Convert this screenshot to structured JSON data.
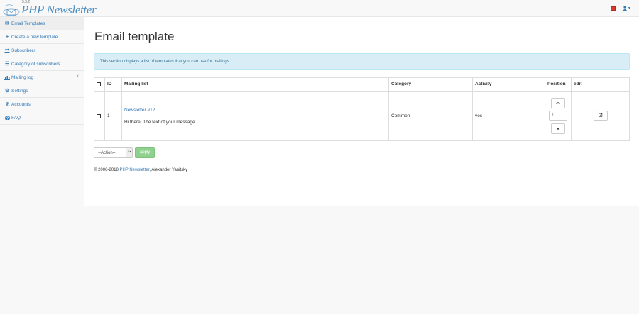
{
  "brand": {
    "name": "PHP Newsletter",
    "version": "5.3.2"
  },
  "header": {
    "user_caret": "▾"
  },
  "sidebar": {
    "items": [
      {
        "label": "Email Templates",
        "icon": "envelope-icon",
        "glyph": "✉"
      },
      {
        "label": "Create a new template",
        "icon": "plus-icon",
        "glyph": "+"
      },
      {
        "label": "Subscribers",
        "icon": "users-icon",
        "glyph": "👥"
      },
      {
        "label": "Category of subscribers",
        "icon": "list-icon",
        "glyph": "☰"
      },
      {
        "label": "Mailing log",
        "icon": "chart-icon",
        "glyph": "▙",
        "caret": "‹"
      },
      {
        "label": "Settings",
        "icon": "gear-icon",
        "glyph": "⚙"
      },
      {
        "label": "Accounts",
        "icon": "key-icon",
        "glyph": "⚷"
      },
      {
        "label": "FAQ",
        "icon": "question-icon",
        "glyph": "?"
      }
    ]
  },
  "main": {
    "title": "Email template",
    "info": "This section displays a list of templates that you can use for mailings.",
    "table": {
      "headers": {
        "id": "ID",
        "mailing_list": "Mailing list",
        "category": "Category",
        "activity": "Activity",
        "position": "Position",
        "edit": "edit"
      },
      "rows": [
        {
          "id": "1",
          "name": "Newsletter #12",
          "body": "Hi there! The text of your message",
          "category": "Common",
          "activity": "yes",
          "position": "1"
        }
      ]
    },
    "action_select": "--Action--",
    "apply_label": "apply",
    "footer": {
      "prefix": "© 2006-2018",
      "link": "PHP Newsletter",
      "suffix": ", Alexander Yanitsky"
    }
  },
  "colors": {
    "accent": "#337ab7",
    "alert_bg": "#d9edf7",
    "apply": "#8fd08f"
  }
}
